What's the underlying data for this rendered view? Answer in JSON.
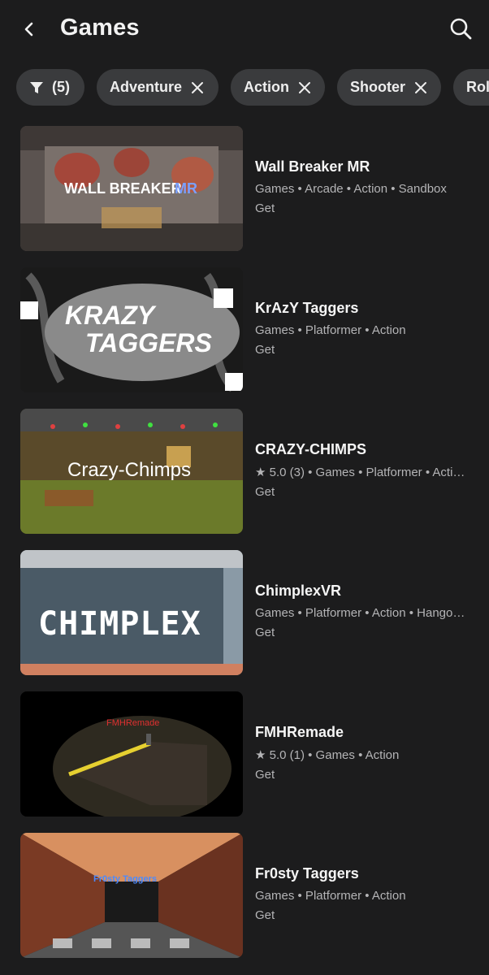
{
  "header": {
    "title": "Games"
  },
  "filters": {
    "filter_count": "(5)",
    "chips": [
      "Adventure",
      "Action",
      "Shooter",
      "Rol"
    ]
  },
  "games": [
    {
      "name": "Wall Breaker MR",
      "meta": "Games • Arcade • Action • Sandbox",
      "action": "Get",
      "thumb_text": "WALL BREAKER",
      "thumb_text2": "MR"
    },
    {
      "name": "KrAzY Taggers",
      "meta": "Games • Platformer • Action",
      "action": "Get",
      "thumb_text": "KRAZY",
      "thumb_text2": "TAGGERS"
    },
    {
      "name": "CRAZY-CHIMPS",
      "meta": "★ 5.0 (3) • Games • Platformer • Acti…",
      "action": "Get",
      "thumb_text": "Crazy-Chimps"
    },
    {
      "name": "ChimplexVR",
      "meta": "Games • Platformer • Action • Hango…",
      "action": "Get",
      "thumb_text": "CHIMPLEX"
    },
    {
      "name": "FMHRemade",
      "meta": "★ 5.0 (1) • Games • Action",
      "action": "Get",
      "thumb_text": "FMHRemade"
    },
    {
      "name": "Fr0sty Taggers",
      "meta": "Games • Platformer • Action",
      "action": "Get",
      "thumb_text": "Fr0sty Taggers"
    }
  ]
}
